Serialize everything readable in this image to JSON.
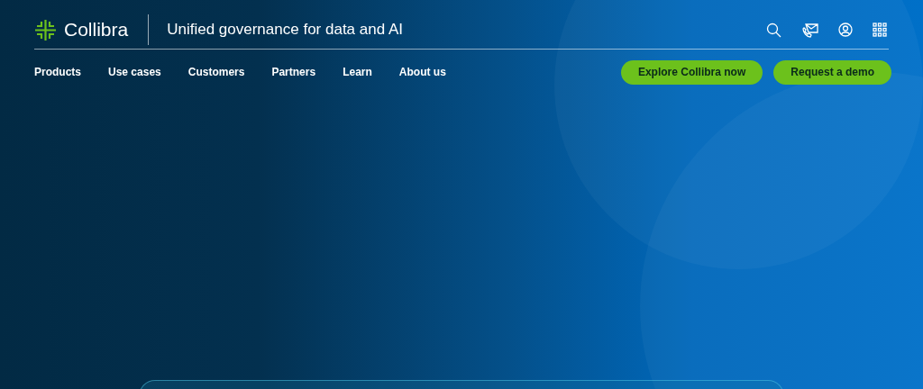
{
  "header": {
    "logo_text": "Collibra",
    "tagline": "Unified governance for data and AI"
  },
  "nav": {
    "items": [
      {
        "label": "Products"
      },
      {
        "label": "Use cases"
      },
      {
        "label": "Customers"
      },
      {
        "label": "Partners"
      },
      {
        "label": "Learn"
      },
      {
        "label": "About us"
      }
    ]
  },
  "buttons": [
    {
      "label": "Explore Collibra now"
    },
    {
      "label": "Request a demo"
    }
  ]
}
